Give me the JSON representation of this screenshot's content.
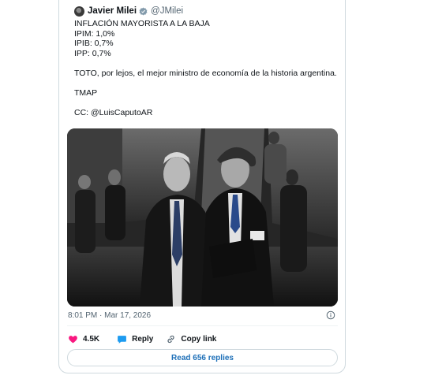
{
  "tweet": {
    "author_name": "Javier Milei",
    "author_handle": "@JMilei",
    "lines": [
      "INFLACIÓN MAYORISTA A LA BAJA",
      "IPIM: 1,0%",
      "IPIB: 0,7%",
      "IPP: 0,7%",
      "",
      "TOTO, por lejos, el mejor ministro de economía de la historia argentina.",
      "",
      "TMAP",
      "",
      "CC: @LuisCaputoAR"
    ],
    "timestamp": "8:01 PM · Mar 17, 2026"
  },
  "actions": {
    "like_count": "4.5K",
    "reply_label": "Reply",
    "copy_link_label": "Copy link"
  },
  "read_replies_label": "Read 656 replies",
  "colors": {
    "like": "#f91880",
    "reply": "#1d9bf0",
    "link_text": "#1d6fb8",
    "verified_badge": "#829aab"
  },
  "icons": [
    "verified-badge-icon",
    "info-icon",
    "heart-icon",
    "reply-bubble-icon",
    "link-icon"
  ]
}
